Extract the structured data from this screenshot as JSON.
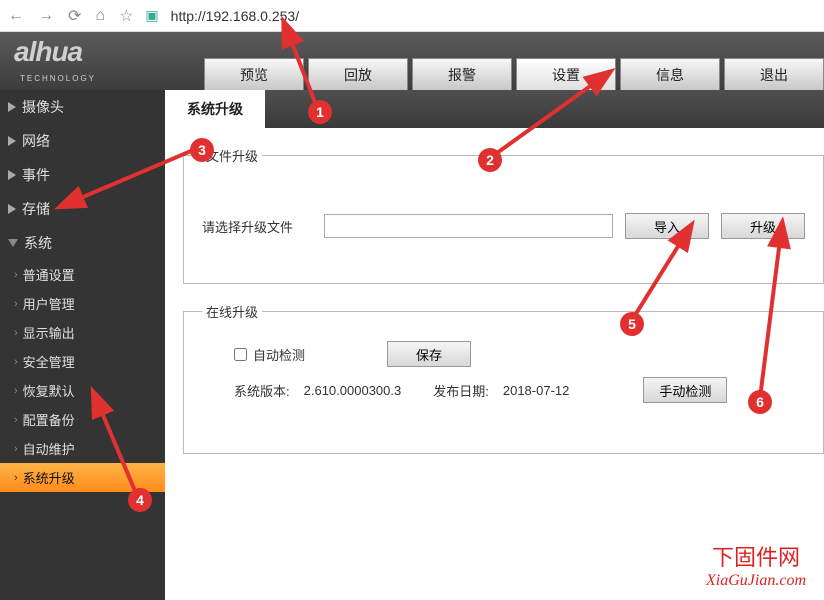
{
  "browser": {
    "url": "http://192.168.0.253/"
  },
  "logo": {
    "brand": "alhua",
    "sub": "TECHNOLOGY"
  },
  "tabs": [
    {
      "label": "预览"
    },
    {
      "label": "回放"
    },
    {
      "label": "报警"
    },
    {
      "label": "设置",
      "active": true
    },
    {
      "label": "信息"
    },
    {
      "label": "退出"
    }
  ],
  "sidebar": {
    "cats": [
      {
        "label": "摄像头"
      },
      {
        "label": "网络"
      },
      {
        "label": "事件"
      },
      {
        "label": "存储"
      },
      {
        "label": "系统",
        "open": true
      }
    ],
    "subs": [
      {
        "label": "普通设置"
      },
      {
        "label": "用户管理"
      },
      {
        "label": "显示输出"
      },
      {
        "label": "安全管理"
      },
      {
        "label": "恢复默认"
      },
      {
        "label": "配置备份"
      },
      {
        "label": "自动维护"
      },
      {
        "label": "系统升级",
        "active": true
      }
    ]
  },
  "content": {
    "title": "系统升级",
    "file": {
      "legend": "文件升级",
      "select_label": "请选择升级文件",
      "import_btn": "导入",
      "upgrade_btn": "升级"
    },
    "online": {
      "legend": "在线升级",
      "auto_check": "自动检测",
      "save_btn": "保存",
      "version_label": "系统版本:",
      "version_value": "2.610.0000300.3",
      "date_label": "发布日期:",
      "date_value": "2018-07-12",
      "manual_btn": "手动检测"
    }
  },
  "annotations": {
    "n1": "1",
    "n2": "2",
    "n3": "3",
    "n4": "4",
    "n5": "5",
    "n6": "6"
  },
  "watermark": {
    "line1": "下固件网",
    "line2": "XiaGuJian.com"
  }
}
